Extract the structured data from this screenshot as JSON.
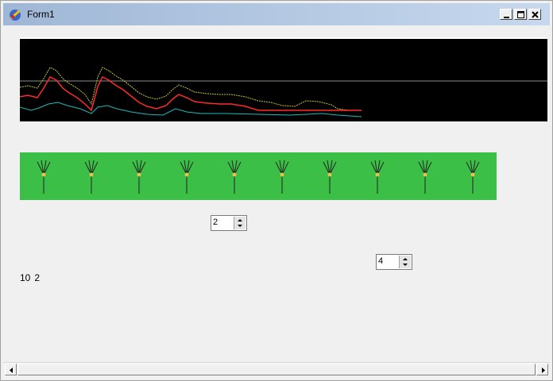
{
  "window": {
    "title": "Form1"
  },
  "titlebar_icons": {
    "app": "app-icon",
    "minimize": "minimize-icon",
    "maximize": "maximize-icon",
    "close": "close-icon"
  },
  "colors": {
    "plot_bg": "#000000",
    "series_yellow": "#c9c32f",
    "series_red": "#ff2a2a",
    "series_cyan": "#1fb9bd",
    "midline": "#8a8a8a",
    "tree_panel": "#3cbf46",
    "tree_stem": "#222222",
    "tree_node": "#e7c24d"
  },
  "trees": {
    "count": 10
  },
  "spin1": {
    "value": "2"
  },
  "spin2": {
    "value": "4"
  },
  "status": {
    "a": "10",
    "b": "2"
  },
  "scrollbar": {
    "left_icon": "arrow-left-icon",
    "right_icon": "arrow-right-icon"
  }
}
